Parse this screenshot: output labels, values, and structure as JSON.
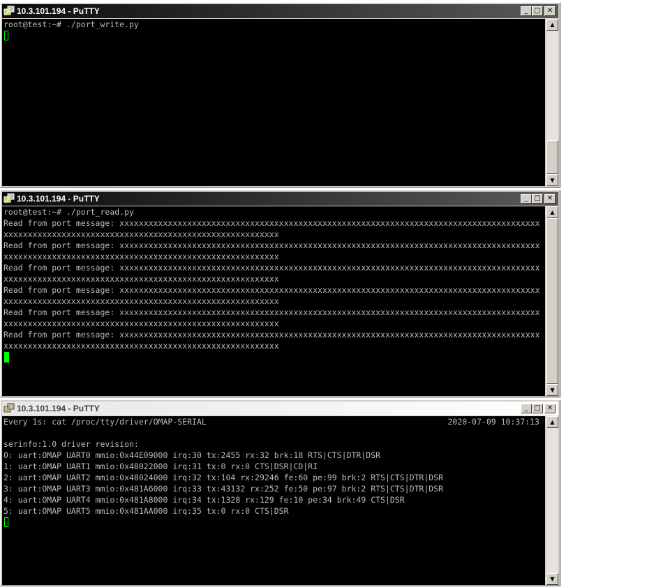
{
  "windows": [
    {
      "title": "10.3.101.194 - PuTTY",
      "active": false,
      "lines": [
        "root@test:~# ./port_write.py"
      ]
    },
    {
      "title": "10.3.101.194 - PuTTY",
      "active": false,
      "lines": [
        "root@test:~# ./port_read.py",
        "Read from port message: xxxxxxxxxxxxxxxxxxxxxxxxxxxxxxxxxxxxxxxxxxxxxxxxxxxxxxxxxxxxxxxxxxxxxxxxxxxxxxxxxxxxxxx",
        "xxxxxxxxxxxxxxxxxxxxxxxxxxxxxxxxxxxxxxxxxxxxxxxxxxxxxxxxx",
        "Read from port message: xxxxxxxxxxxxxxxxxxxxxxxxxxxxxxxxxxxxxxxxxxxxxxxxxxxxxxxxxxxxxxxxxxxxxxxxxxxxxxxxxxxxxxx",
        "xxxxxxxxxxxxxxxxxxxxxxxxxxxxxxxxxxxxxxxxxxxxxxxxxxxxxxxxx",
        "Read from port message: xxxxxxxxxxxxxxxxxxxxxxxxxxxxxxxxxxxxxxxxxxxxxxxxxxxxxxxxxxxxxxxxxxxxxxxxxxxxxxxxxxxxxxx",
        "xxxxxxxxxxxxxxxxxxxxxxxxxxxxxxxxxxxxxxxxxxxxxxxxxxxxxxxxx",
        "Read from port message: xxxxxxxxxxxxxxxxxxxxxxxxxxxxxxxxxxxxxxxxxxxxxxxxxxxxxxxxxxxxxxxxxxxxxxxxxxxxxxxxxxxxxxx",
        "xxxxxxxxxxxxxxxxxxxxxxxxxxxxxxxxxxxxxxxxxxxxxxxxxxxxxxxxx",
        "Read from port message: xxxxxxxxxxxxxxxxxxxxxxxxxxxxxxxxxxxxxxxxxxxxxxxxxxxxxxxxxxxxxxxxxxxxxxxxxxxxxxxxxxxxxxx",
        "xxxxxxxxxxxxxxxxxxxxxxxxxxxxxxxxxxxxxxxxxxxxxxxxxxxxxxxxx",
        "Read from port message: xxxxxxxxxxxxxxxxxxxxxxxxxxxxxxxxxxxxxxxxxxxxxxxxxxxxxxxxxxxxxxxxxxxxxxxxxxxxxxxxxxxxxxx",
        "xxxxxxxxxxxxxxxxxxxxxxxxxxxxxxxxxxxxxxxxxxxxxxxxxxxxxxxxx"
      ]
    },
    {
      "title": "10.3.101.194 - PuTTY",
      "active": true,
      "header_left": "Every 1s: cat /proc/tty/driver/OMAP-SERIAL",
      "header_right": "2020-07-09 10:37:13",
      "lines": [
        "",
        "serinfo:1.0 driver revision:",
        "0: uart:OMAP UART0 mmio:0x44E09000 irq:30 tx:2455 rx:32 brk:18 RTS|CTS|DTR|DSR",
        "1: uart:OMAP UART1 mmio:0x48022000 irq:31 tx:0 rx:0 CTS|DSR|CD|RI",
        "2: uart:OMAP UART2 mmio:0x48024000 irq:32 tx:104 rx:29246 fe:60 pe:99 brk:2 RTS|CTS|DTR|DSR",
        "3: uart:OMAP UART3 mmio:0x481A6000 irq:33 tx:43132 rx:252 fe:50 pe:97 brk:2 RTS|CTS|DTR|DSR",
        "4: uart:OMAP UART4 mmio:0x481A8000 irq:34 tx:1328 rx:129 fe:10 pe:34 brk:49 CTS|DSR",
        "5: uart:OMAP UART5 mmio:0x481AA000 irq:35 tx:0 rx:0 CTS|DSR"
      ]
    }
  ],
  "icons": {
    "window_icon": "putty-icon",
    "minimize": "minimize-icon",
    "maximize": "maximize-icon",
    "close": "close-icon",
    "scroll_up": "arrow-up-icon",
    "scroll_down": "arrow-down-icon"
  },
  "colors": {
    "terminal_bg": "#000000",
    "terminal_fg": "#bbbbbb",
    "cursor": "#00ff00",
    "chrome": "#d4d0c8"
  }
}
